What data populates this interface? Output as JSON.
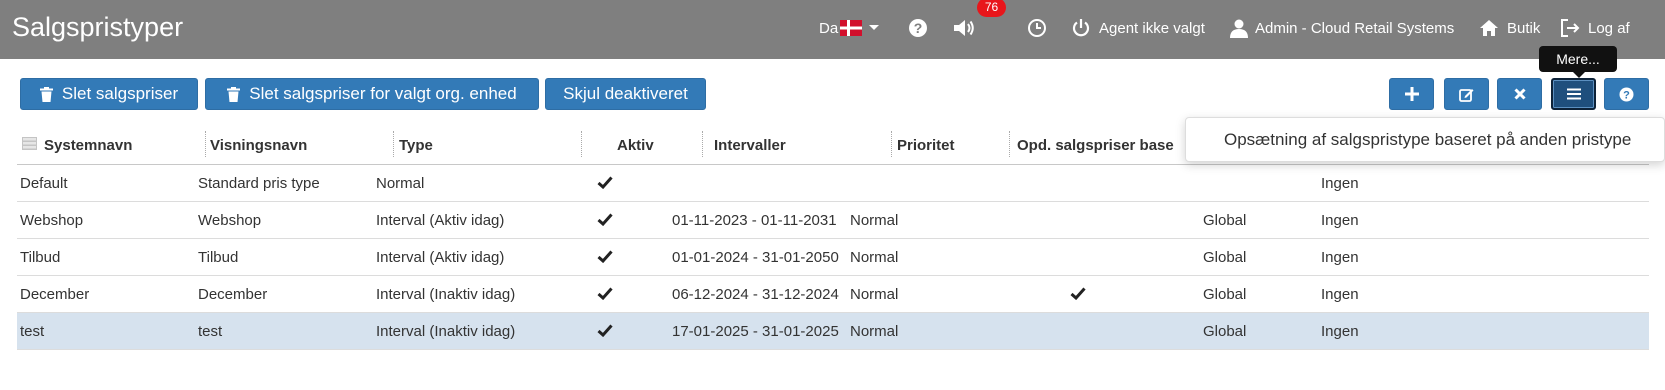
{
  "header": {
    "title": "Salgspristyper",
    "language": "Da",
    "notification_count": "76",
    "agent": "Agent ikke valgt",
    "user": "Admin - Cloud Retail Systems",
    "shop": "Butik",
    "logout": "Log af"
  },
  "toolbar": {
    "delete_prices": "Slet salgspriser",
    "delete_prices_org": "Slet salgspriser for valgt org. enhed",
    "hide_deactivated": "Skjul deaktiveret",
    "more_tooltip": "Mere...",
    "icons": [
      "plus-icon",
      "edit-icon",
      "close-icon",
      "menu-icon",
      "help-icon"
    ]
  },
  "dropdown": {
    "item": "Opsætning af salgspristype baseret på anden pristype"
  },
  "table": {
    "columns": [
      "Systemnavn",
      "Visningsnavn",
      "Type",
      "Aktiv",
      "Intervaller",
      "Prioritet",
      "Opd. salgspriser base"
    ],
    "rows": [
      {
        "system": "Default",
        "display": "Standard pris type",
        "type": "Normal",
        "active": true,
        "interval": "",
        "priority": "",
        "opd": false,
        "scope": "",
        "base": "Ingen"
      },
      {
        "system": "Webshop",
        "display": "Webshop",
        "type": "Interval (Aktiv idag)",
        "active": true,
        "interval": "01-11-2023 - 01-11-2031",
        "priority": "Normal",
        "opd": false,
        "scope": "Global",
        "base": "Ingen"
      },
      {
        "system": "Tilbud",
        "display": "Tilbud",
        "type": "Interval (Aktiv idag)",
        "active": true,
        "interval": "01-01-2024 - 31-01-2050",
        "priority": "Normal",
        "opd": false,
        "scope": "Global",
        "base": "Ingen"
      },
      {
        "system": "December",
        "display": "December",
        "type": "Interval (Inaktiv idag)",
        "active": true,
        "interval": "06-12-2024 - 31-12-2024",
        "priority": "Normal",
        "opd": true,
        "scope": "Global",
        "base": "Ingen"
      },
      {
        "system": "test",
        "display": "test",
        "type": "Interval (Inaktiv idag)",
        "active": true,
        "interval": "17-01-2025 - 31-01-2025",
        "priority": "Normal",
        "opd": false,
        "scope": "Global",
        "base": "Ingen",
        "selected": true
      }
    ]
  },
  "colors": {
    "topbar": "#7f7f7f",
    "primary": "#337ab7",
    "selected_row": "#d6e2ee",
    "badge": "#e8161b"
  }
}
